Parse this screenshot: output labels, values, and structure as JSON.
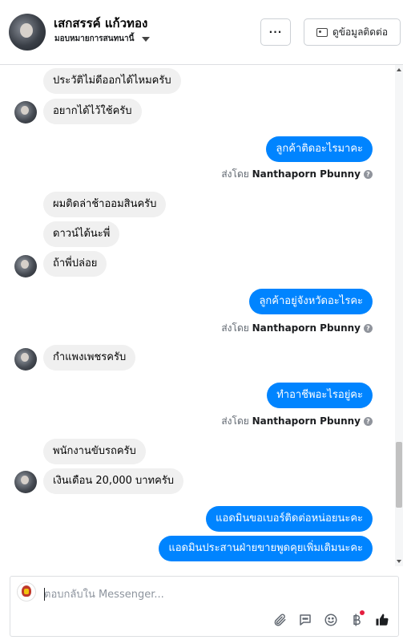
{
  "header": {
    "contact_name": "เสกสรรค์ แก้วทอง",
    "assign_label": "มอบหมายการสนทนานี้",
    "more_label": "···",
    "contact_info_label": "ดูข้อมูลติดต่อ"
  },
  "messages": {
    "m1": "ประวัติไม่ดีออกได้ไหมครับ",
    "m2": "อยากได้ไว้ใช้ครับ",
    "m3": "ลูกค้าติดอะไรมาคะ",
    "m4": "ผมติดล่าช้าออมสินครับ",
    "m5": "ดาวน์ได้นะพี่",
    "m6": "ถ้าพี่ปล่อย",
    "m7": "ลูกค้าอยู่จังหวัดอะไรคะ",
    "m8": "กำแพงเพชรครับ",
    "m9": "ทำอาชีพอะไรอยู่คะ",
    "m10": "พนักงานขับรถครับ",
    "m11": "เงินเดือน 20,000 บาทครับ",
    "m12": "แอดมินขอเบอร์ติดต่อหน่อยนะคะ",
    "m13": "แอดมินประสานฝ่ายขายพูดคุยเพิ่มเติมนะคะ"
  },
  "sent_by": {
    "prefix": "ส่งโดย",
    "sender": "Nanthaporn Pbunny",
    "help": "?"
  },
  "composer": {
    "placeholder": "ตอบกลับใน Messenger..."
  },
  "icons": {
    "attach": "paperclip-icon",
    "saved_replies": "chat-bubble-icon",
    "emoji": "smiley-icon",
    "payment": "baht-icon",
    "like": "thumbs-up-icon"
  },
  "colors": {
    "outgoing_bubble": "#0084ff",
    "incoming_bubble": "#f0f0f0",
    "like_icon": "#1c1e21"
  }
}
